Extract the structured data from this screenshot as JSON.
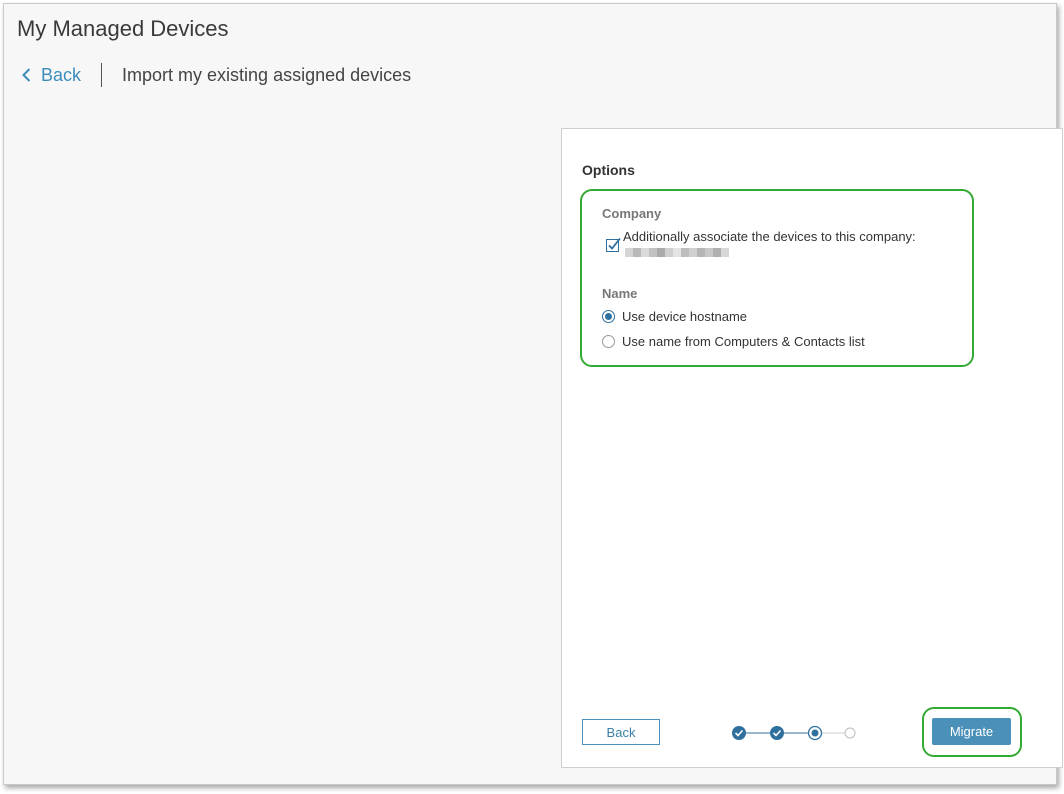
{
  "app": {
    "title": "My Managed Devices"
  },
  "nav": {
    "back_label": "Back",
    "page_title": "Import my existing assigned devices"
  },
  "options": {
    "title": "Options",
    "company": {
      "label": "Company",
      "checkbox_label": "Additionally associate the devices to this company:",
      "checked": true
    },
    "name": {
      "label": "Name",
      "radios": [
        {
          "label": "Use device hostname",
          "selected": true
        },
        {
          "label": "Use name from Computers & Contacts list",
          "selected": false
        }
      ]
    }
  },
  "footer": {
    "back_label": "Back",
    "migrate_label": "Migrate",
    "steps": {
      "total": 4,
      "completed": 2,
      "current": 3
    }
  },
  "colors": {
    "accent": "#4a90b8",
    "link": "#3c8dbc",
    "highlight": "#33aa33"
  }
}
